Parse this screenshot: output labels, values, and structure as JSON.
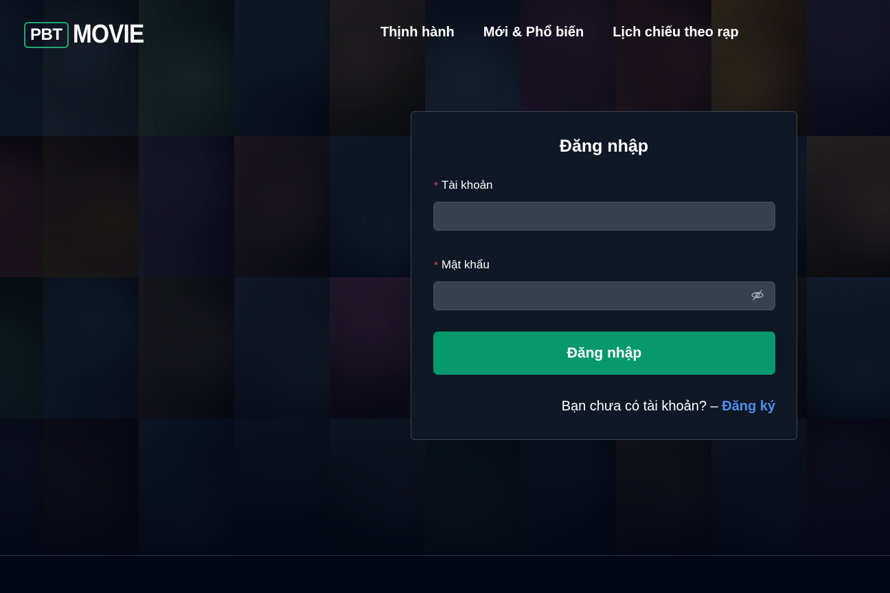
{
  "header": {
    "logo_box": "PBT",
    "logo_text": "MOVIE",
    "nav": [
      {
        "label": "Thịnh hành"
      },
      {
        "label": "Mới & Phổ biến"
      },
      {
        "label": "Lịch chiếu theo rạp"
      }
    ]
  },
  "login": {
    "title": "Đăng nhập",
    "username_label": "Tài khoản",
    "username_value": "",
    "password_label": "Mật khẩu",
    "password_value": "",
    "required_mark": "*",
    "submit_label": "Đăng nhập",
    "signup_prompt": "Bạn chưa có tài khoản? – ",
    "signup_link": "Đăng ký"
  },
  "colors": {
    "background": "#040814",
    "card": "#101826",
    "accent_green": "#07996c",
    "logo_border": "#23a874",
    "link_blue": "#4f8ef0",
    "required_red": "#e5484d"
  },
  "icons": [
    "eye-off-icon"
  ]
}
